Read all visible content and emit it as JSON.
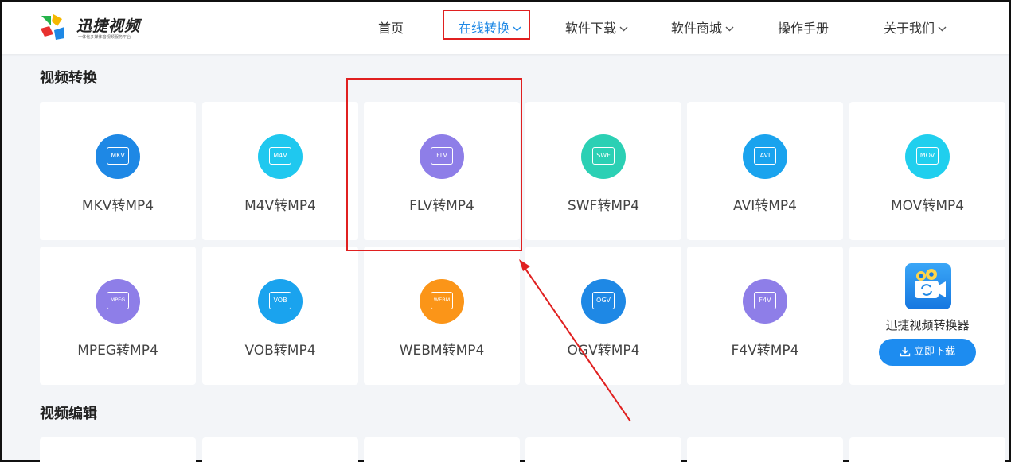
{
  "brand": {
    "name": "迅捷视频",
    "slogan": "一体化多媒体音视频服务平台"
  },
  "nav": {
    "items": [
      {
        "label": "首页",
        "dropdown": false,
        "active": false
      },
      {
        "label": "在线转换",
        "dropdown": true,
        "active": true
      },
      {
        "label": "软件下载",
        "dropdown": true,
        "active": false
      },
      {
        "label": "软件商城",
        "dropdown": true,
        "active": false
      },
      {
        "label": "操作手册",
        "dropdown": false,
        "active": false
      },
      {
        "label": "关于我们",
        "dropdown": true,
        "active": false
      }
    ]
  },
  "sections": {
    "video_convert": {
      "title": "视频转换",
      "cards": [
        {
          "label": "MKV转MP4",
          "format": "MKV",
          "color": "#1e88e5",
          "icon": "mkv-file-icon"
        },
        {
          "label": "M4V转MP4",
          "format": "M4V",
          "color": "#1fc8ef",
          "icon": "m4v-file-icon"
        },
        {
          "label": "FLV转MP4",
          "format": "FLV",
          "color": "#8e7ee8",
          "icon": "flv-file-icon"
        },
        {
          "label": "SWF转MP4",
          "format": "SWF",
          "color": "#2bd0b4",
          "icon": "swf-file-icon"
        },
        {
          "label": "AVI转MP4",
          "format": "AVI",
          "color": "#1aa3ee",
          "icon": "avi-file-icon"
        },
        {
          "label": "MOV转MP4",
          "format": "MOV",
          "color": "#20cfee",
          "icon": "mov-file-icon"
        },
        {
          "label": "MPEG转MP4",
          "format": "MPEG",
          "color": "#8e7ee8",
          "icon": "mpeg-file-icon"
        },
        {
          "label": "VOB转MP4",
          "format": "VOB",
          "color": "#1aa3ee",
          "icon": "vob-file-icon"
        },
        {
          "label": "WEBM转MP4",
          "format": "WEBM",
          "color": "#fb9518",
          "icon": "webm-file-icon"
        },
        {
          "label": "OGV转MP4",
          "format": "OGV",
          "color": "#1e88e5",
          "icon": "ogv-file-icon"
        },
        {
          "label": "F4V转MP4",
          "format": "F4V",
          "color": "#8e7ee8",
          "icon": "f4v-file-icon"
        }
      ],
      "promo": {
        "title": "迅捷视频转换器",
        "button": "立即下载",
        "icon": "video-converter-app-icon"
      }
    },
    "video_edit": {
      "title": "视频编辑"
    }
  },
  "annotation": {
    "highlight_color": "#e02020"
  }
}
